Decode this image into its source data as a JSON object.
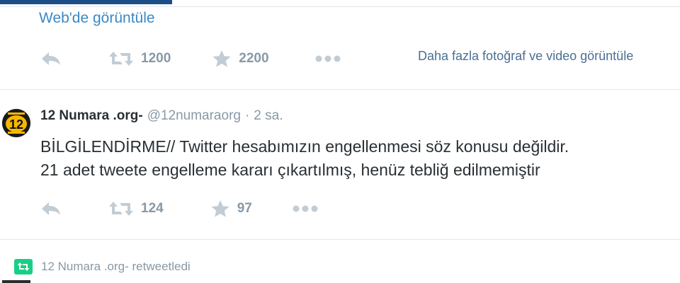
{
  "top_link": {
    "label": "Web'de görüntüle"
  },
  "first_tweet_actions": {
    "retweet_count": "1200",
    "favorite_count": "2200"
  },
  "more_media_link": "Daha fazla fotoğraf ve video görüntüle",
  "tweet": {
    "fullname": "12 Numara .org-",
    "handle": "@12numaraorg",
    "separator": "·",
    "time": "2 sa.",
    "avatar_text": "12",
    "text_line_1": "BİLGİLENDİRME// Twitter hesabımızın engellenmesi söz konusu değildir.",
    "text_line_2": "21 adet tweete engelleme kararı çıkartılmış, henüz tebliğ edilmemiştir",
    "retweet_count": "124",
    "favorite_count": "97"
  },
  "retweet_context": {
    "text": "12 Numara .org- retweetledi"
  },
  "colors": {
    "link": "#3b88c3",
    "muted": "#8899a6",
    "text": "#292f33",
    "retweet_green": "#19cf86",
    "avatar_gold": "#f5b800",
    "active_tab": "#1b4e86"
  },
  "icons": [
    "reply-icon",
    "retweet-icon",
    "star-icon",
    "more-dots-icon",
    "retweet-badge-icon"
  ]
}
